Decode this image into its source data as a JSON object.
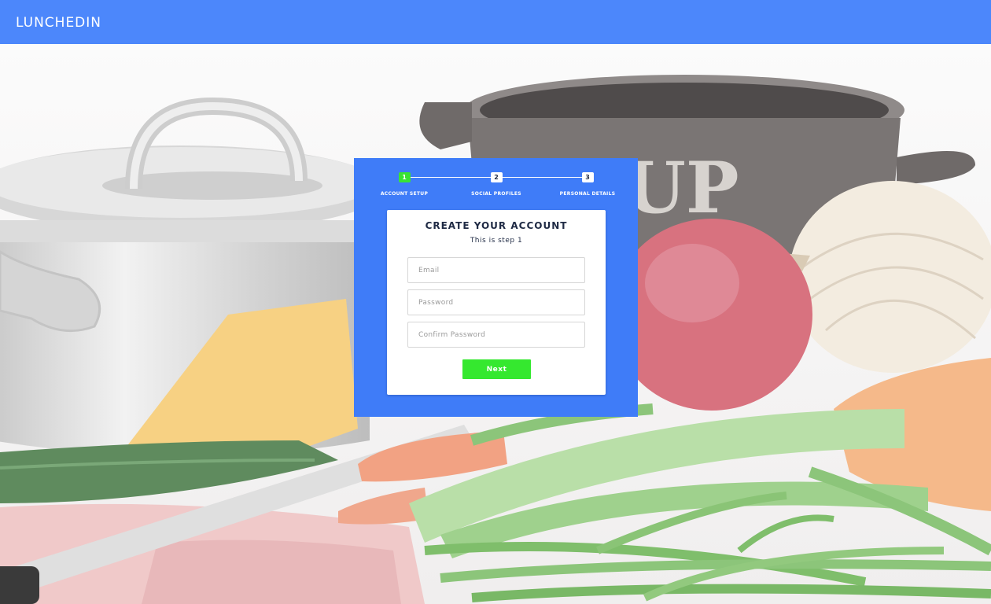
{
  "navbar": {
    "brand": "LUNCHEDIN",
    "color": "#4c87fb"
  },
  "background": {
    "description_icon": "kitchen-photo",
    "pot_lettering": "SOUP"
  },
  "signup": {
    "steps": [
      {
        "number": "1",
        "label": "ACCOUNT SETUP",
        "active": true
      },
      {
        "number": "2",
        "label": "SOCIAL PROFILES",
        "active": false
      },
      {
        "number": "3",
        "label": "PERSONAL DETAILS",
        "active": false
      }
    ],
    "title": "CREATE YOUR ACCOUNT",
    "subtitle": "This is step 1",
    "fields": {
      "email": {
        "placeholder": "Email",
        "value": ""
      },
      "password": {
        "placeholder": "Password",
        "value": ""
      },
      "confirm_password": {
        "placeholder": "Confirm Password",
        "value": ""
      }
    },
    "next_label": "Next",
    "colors": {
      "card": "#3f7cf8",
      "active_step": "#39e334",
      "next_button": "#35e82f"
    }
  }
}
